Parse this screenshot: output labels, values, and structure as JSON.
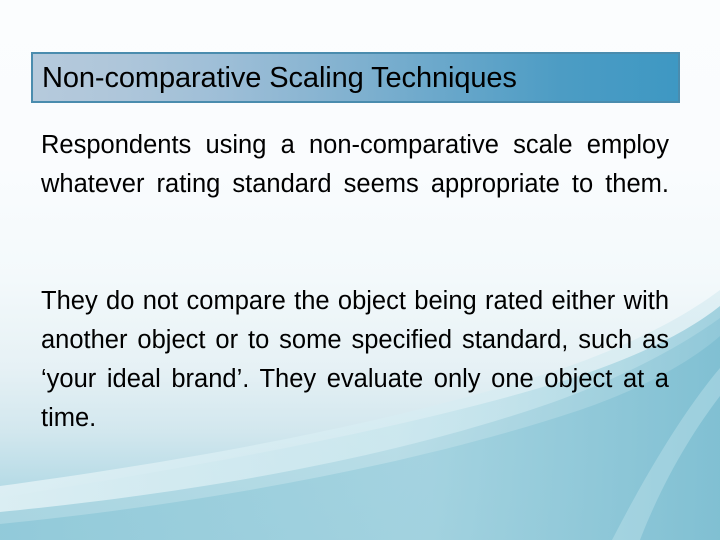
{
  "slide": {
    "title": "Non-comparative Scaling Techniques",
    "paragraphs": [
      "Respondents using a non-comparative scale employ whatever rating standard seems appropriate to them.",
      "They do not compare the object being rated either with another object or to some specified standard, such as ‘your ideal brand’. They evaluate only one object at a time."
    ]
  },
  "colors": {
    "title_border": "#4a8cae",
    "title_gradient_start": "#b6cadc",
    "title_gradient_end": "#3e98c3",
    "title_text": "#000000",
    "body_text": "#000000",
    "background_top": "#fbfdfe",
    "background_bottom": "#93c9d9",
    "wave_light": "#cfe7ee",
    "wave_mid": "#a8d4e0"
  }
}
